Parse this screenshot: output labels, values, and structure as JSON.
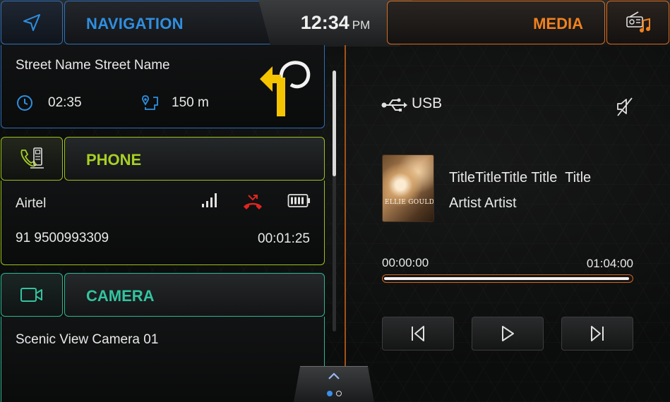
{
  "clock": {
    "time": "12:34",
    "ampm": "PM"
  },
  "navigation": {
    "title": "NAVIGATION",
    "street": "Street Name Street Name",
    "eta": "02:35",
    "distance": "150 m",
    "accent": "#2f8fe0",
    "icon": "navigation-arrow-icon",
    "turn_icon": "u-turn-left-icon"
  },
  "media": {
    "title": "MEDIA",
    "accent": "#f0821f",
    "icon": "radio-music-icon",
    "source": "USB",
    "album_text": "ELLIE GOULDING",
    "track_title": "TitleTitleTitle Title  Title",
    "track_artist": "Artist Artist",
    "time_current": "00:00:00",
    "time_total": "01:04:00",
    "progress_fraction": 0.99
  },
  "phone": {
    "title": "PHONE",
    "accent": "#a7cf24",
    "carrier": "Airtel",
    "number": "91 9500993309",
    "call_duration": "00:01:25"
  },
  "camera": {
    "title": "CAMERA",
    "accent": "#32c4a0",
    "name": "Scenic View Camera 01"
  },
  "pager": {
    "pages": 2,
    "active_page": 1
  }
}
